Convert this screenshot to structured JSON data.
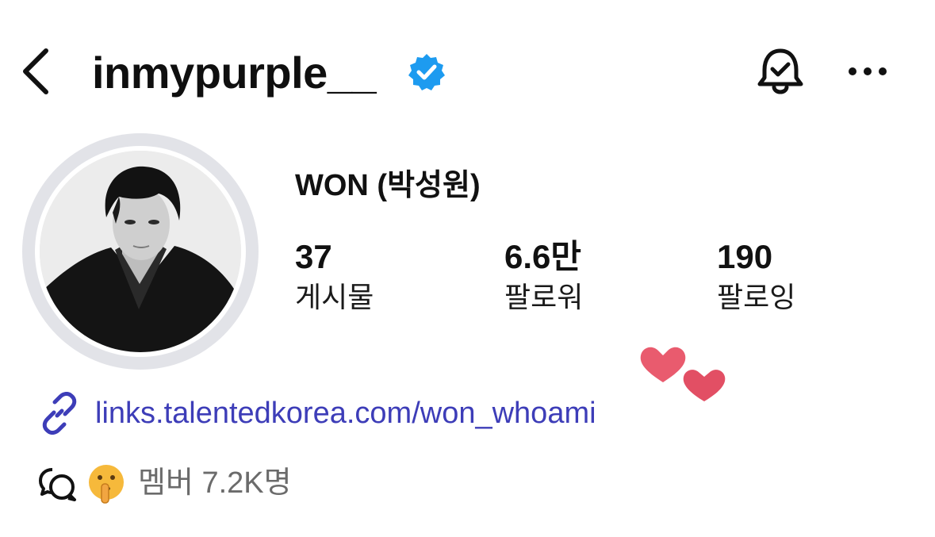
{
  "header": {
    "username": "inmypurple__",
    "verified": true,
    "icons": {
      "back": "chevron-left-icon",
      "verified": "verified-badge-icon",
      "notifications": "bell-check-icon",
      "more": "more-horizontal-icon"
    }
  },
  "profile": {
    "display_name": "WON (박성원)",
    "stats": {
      "posts": {
        "value": "37",
        "label": "게시물"
      },
      "followers": {
        "value": "6.6만",
        "label": "팔로워"
      },
      "following": {
        "value": "190",
        "label": "팔로잉"
      }
    }
  },
  "link": {
    "text": "links.talentedkorea.com/won_whoami",
    "icon": "link-icon"
  },
  "community": {
    "icon": "chat-bubbles-icon",
    "emoji": "shushing-face-emoji",
    "text": "멤버 7.2K명"
  },
  "decoration": {
    "stickers": "two-hearts-sticker"
  },
  "colors": {
    "verified_blue": "#1d9bf0",
    "link_blue": "#3d3db8",
    "heart_pink": "#e95b6e",
    "muted_text": "#6b6b6b",
    "avatar_ring": "#e2e3e8"
  }
}
